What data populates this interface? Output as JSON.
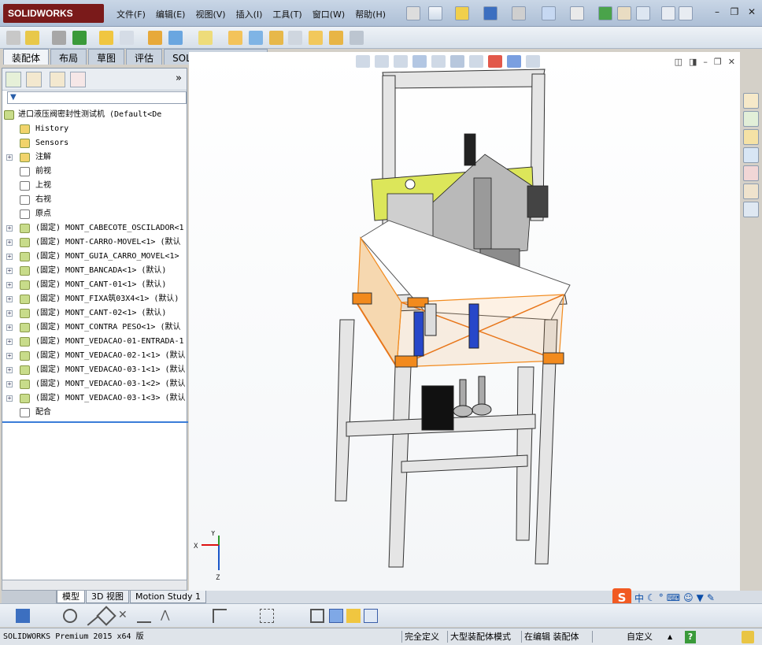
{
  "app": {
    "logo": "SOLIDWORKS"
  },
  "menu": [
    "文件(F)",
    "编辑(E)",
    "视图(V)",
    "插入(I)",
    "工具(T)",
    "窗口(W)",
    "帮助(H)"
  ],
  "command_tabs": [
    "装配体",
    "布局",
    "草图",
    "评估",
    "SOLIDWORKS 插件"
  ],
  "panel": {
    "expand_label": "»"
  },
  "tree": {
    "root": "进口液压阀密封性测试机  (Default<De",
    "items": [
      {
        "label": "History",
        "kind": "history",
        "expandable": false
      },
      {
        "label": "Sensors",
        "kind": "sensors",
        "expandable": false
      },
      {
        "label": "注解",
        "kind": "annotation",
        "expandable": true
      },
      {
        "label": "前视",
        "kind": "plane",
        "expandable": false
      },
      {
        "label": "上视",
        "kind": "plane",
        "expandable": false
      },
      {
        "label": "右视",
        "kind": "plane",
        "expandable": false
      },
      {
        "label": "原点",
        "kind": "origin",
        "expandable": false
      },
      {
        "label": "(固定) MONT_CABECOTE_OSCILADOR<1",
        "kind": "assembly",
        "expandable": true
      },
      {
        "label": "(固定) MONT-CARRO-MOVEL<1> (默认",
        "kind": "assembly",
        "expandable": true
      },
      {
        "label": "(固定) MONT_GUIA_CARRO_MOVEL<1>",
        "kind": "assembly",
        "expandable": true
      },
      {
        "label": "(固定) MONT_BANCADA<1> (默认)",
        "kind": "assembly",
        "expandable": true
      },
      {
        "label": "(固定) MONT_CANT-01<1> (默认)",
        "kind": "assembly",
        "expandable": true
      },
      {
        "label": "(固定) MONT_FIXA筑03X4<1> (默认)",
        "kind": "assembly",
        "expandable": true
      },
      {
        "label": "(固定) MONT_CANT-02<1> (默认)",
        "kind": "assembly",
        "expandable": true
      },
      {
        "label": "(固定) MONT_CONTRA PESO<1> (默认",
        "kind": "assembly",
        "expandable": true
      },
      {
        "label": "(固定) MONT_VEDACAO-01-ENTRADA-1",
        "kind": "assembly",
        "expandable": true
      },
      {
        "label": "(固定) MONT_VEDACAO-02-1<1> (默认",
        "kind": "assembly",
        "expandable": true
      },
      {
        "label": "(固定) MONT_VEDACAO-03-1<1> (默认",
        "kind": "assembly",
        "expandable": true
      },
      {
        "label": "(固定) MONT_VEDACAO-03-1<2> (默认",
        "kind": "assembly",
        "expandable": true
      },
      {
        "label": "(固定) MONT_VEDACAO-03-1<3> (默认",
        "kind": "assembly",
        "expandable": true
      },
      {
        "label": "配合",
        "kind": "mates",
        "expandable": false
      }
    ]
  },
  "triad": {
    "x": "X",
    "y": "Y",
    "z": "Z"
  },
  "model_tabs": [
    "模型",
    "3D 视图",
    "Motion Study 1"
  ],
  "ime": {
    "logo": "S",
    "mode": "中"
  },
  "status": {
    "product": "SOLIDWORKS Premium 2015 x64 版",
    "definition": "完全定义",
    "mode": "大型装配体模式",
    "editing": "在编辑 装配体",
    "units": "自定义",
    "up_arrow": "▲",
    "help": "?"
  },
  "colors": {
    "accent": "#3b7dd8",
    "frame": "#e3e3e3",
    "guard": "#f28a1d",
    "plate": "#dce65a",
    "logo": "#7a1a1a"
  }
}
